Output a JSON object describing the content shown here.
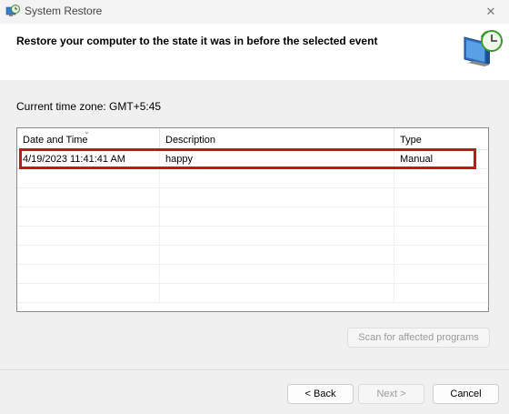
{
  "window": {
    "title": "System Restore",
    "close_glyph": "✕",
    "icon": "system-restore-icon"
  },
  "header": {
    "text": "Restore your computer to the state it was in before the selected event",
    "icon": "restore-monitor-clock-icon"
  },
  "timezone_label": "Current time zone: GMT+5:45",
  "list": {
    "columns": [
      "Date and Time",
      "Description",
      "Type"
    ],
    "sort_glyph": "⌄",
    "rows": [
      {
        "date": "4/19/2023 11:41:41 AM",
        "description": "happy",
        "type": "Manual"
      }
    ],
    "highlight_color": "#c4151b"
  },
  "buttons": {
    "scan": "Scan for affected programs",
    "back": "< Back",
    "next": "Next >",
    "cancel": "Cancel"
  }
}
